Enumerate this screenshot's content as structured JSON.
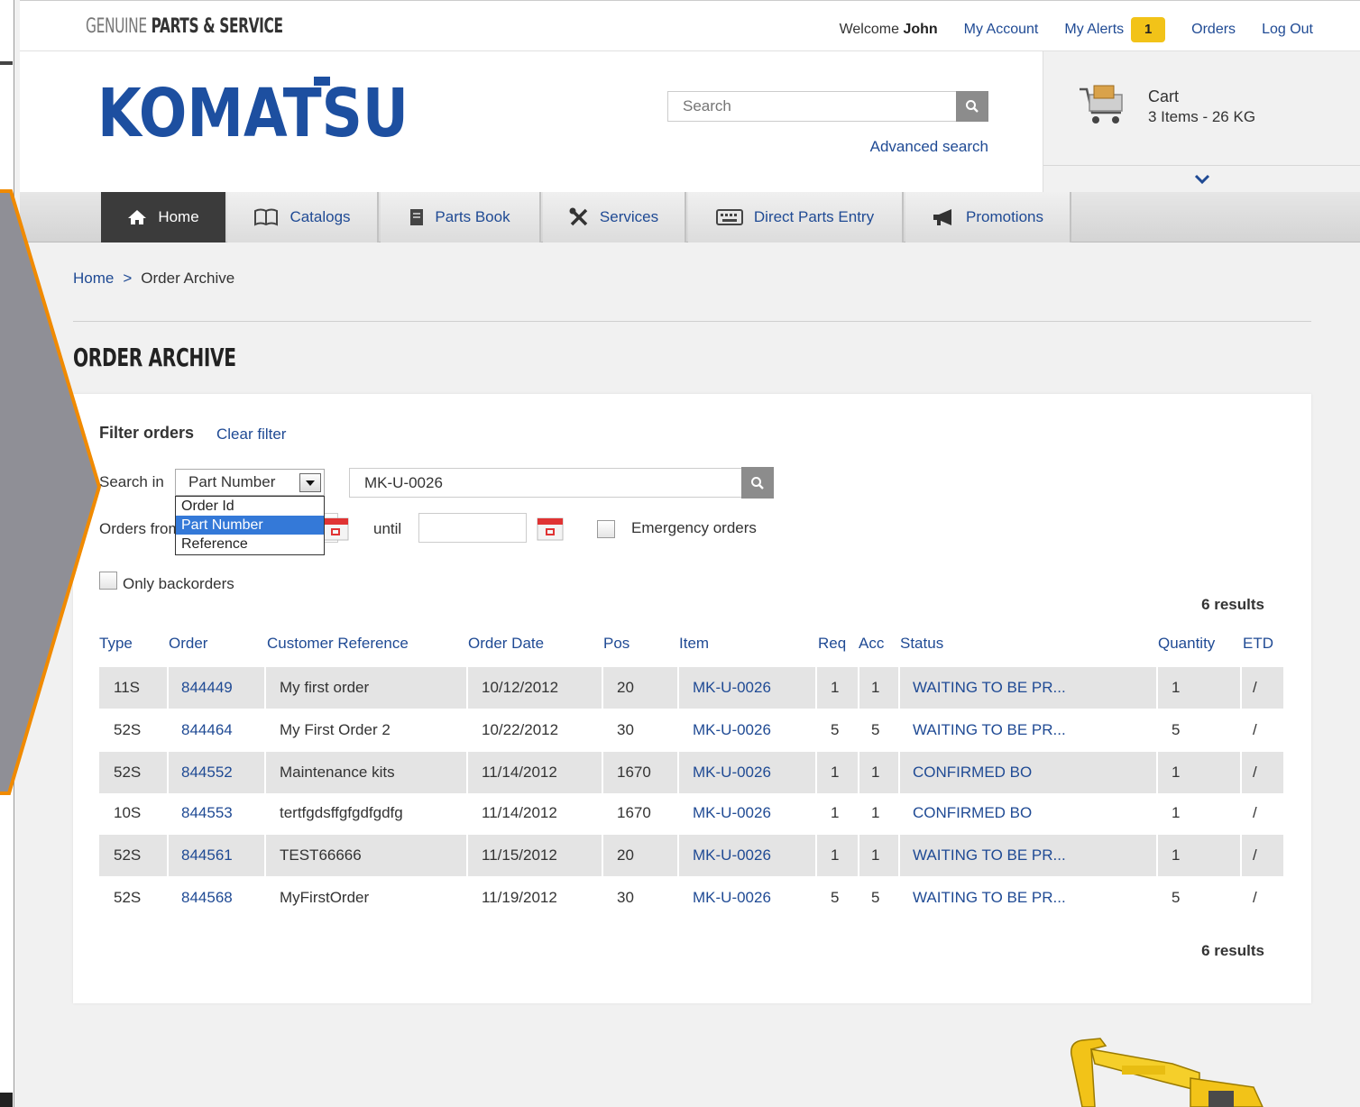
{
  "topbar": {
    "tagline_light": "GENUINE",
    "tagline_bold": "PARTS & SERVICE",
    "welcome_prefix": "Welcome",
    "user_name": "John",
    "links": {
      "my_account": "My Account",
      "my_alerts": "My Alerts",
      "alerts_count": "1",
      "orders": "Orders",
      "log_out": "Log Out"
    }
  },
  "header": {
    "logo_text": "KOMATSU",
    "search_placeholder": "Search",
    "advanced_search": "Advanced search"
  },
  "cart": {
    "title": "Cart",
    "summary": "3 Items - 26 KG"
  },
  "nav": {
    "items": [
      {
        "label": "Home",
        "icon": "home-icon",
        "active": true
      },
      {
        "label": "Catalogs",
        "icon": "book-icon"
      },
      {
        "label": "Parts Book",
        "icon": "document-icon"
      },
      {
        "label": "Services",
        "icon": "tools-icon"
      },
      {
        "label": "Direct Parts Entry",
        "icon": "keyboard-icon"
      },
      {
        "label": "Promotions",
        "icon": "megaphone-icon"
      }
    ]
  },
  "breadcrumb": {
    "home": "Home",
    "separator": ">",
    "current": "Order Archive"
  },
  "page": {
    "title": "ORDER ARCHIVE"
  },
  "filter": {
    "title": "Filter orders",
    "clear": "Clear filter",
    "search_in_label": "Search in",
    "search_in_value": "Part Number",
    "search_in_options": [
      "Order Id",
      "Part Number",
      "Reference"
    ],
    "search_term": "MK-U-0026",
    "orders_from_label": "Orders from",
    "until_label": "until",
    "emergency_label": "Emergency orders",
    "backorders_label": "Only backorders"
  },
  "results_label": "6 results",
  "table": {
    "headers": {
      "type": "Type",
      "order": "Order",
      "customer_reference": "Customer Reference",
      "order_date": "Order Date",
      "pos": "Pos",
      "item": "Item",
      "req": "Req",
      "acc": "Acc",
      "status": "Status",
      "quantity": "Quantity",
      "etd": "ETD"
    },
    "rows": [
      {
        "type": "11S",
        "order": "844449",
        "ref": "My first order",
        "date": "10/12/2012",
        "pos": "20",
        "item": "MK-U-0026",
        "req": "1",
        "acc": "1",
        "status": "WAITING TO BE PR...",
        "qty": "1",
        "etd": "/"
      },
      {
        "type": "52S",
        "order": "844464",
        "ref": "My First Order 2",
        "date": "10/22/2012",
        "pos": "30",
        "item": "MK-U-0026",
        "req": "5",
        "acc": "5",
        "status": "WAITING TO BE PR...",
        "qty": "5",
        "etd": "/"
      },
      {
        "type": "52S",
        "order": "844552",
        "ref": "Maintenance kits",
        "date": "11/14/2012",
        "pos": "1670",
        "item": "MK-U-0026",
        "req": "1",
        "acc": "1",
        "status": "CONFIRMED BO",
        "qty": "1",
        "etd": "/"
      },
      {
        "type": "10S",
        "order": "844553",
        "ref": "tertfgdsffgfgdfgdfg",
        "date": "11/14/2012",
        "pos": "1670",
        "item": "MK-U-0026",
        "req": "1",
        "acc": "1",
        "status": "CONFIRMED BO",
        "qty": "1",
        "etd": "/"
      },
      {
        "type": "52S",
        "order": "844561",
        "ref": "TEST66666",
        "date": "11/15/2012",
        "pos": "20",
        "item": "MK-U-0026",
        "req": "1",
        "acc": "1",
        "status": "WAITING TO BE PR...",
        "qty": "1",
        "etd": "/"
      },
      {
        "type": "52S",
        "order": "844568",
        "ref": "MyFirstOrder",
        "date": "11/19/2012",
        "pos": "30",
        "item": "MK-U-0026",
        "req": "5",
        "acc": "5",
        "status": "WAITING TO BE PR...",
        "qty": "5",
        "etd": "/"
      }
    ]
  },
  "colors": {
    "link_blue": "#1f4a94",
    "komatsu_blue": "#1d4fa0",
    "alert_yellow": "#f2c318",
    "nav_active": "#3b3b3b",
    "orange_arrow": "#f08a00"
  }
}
